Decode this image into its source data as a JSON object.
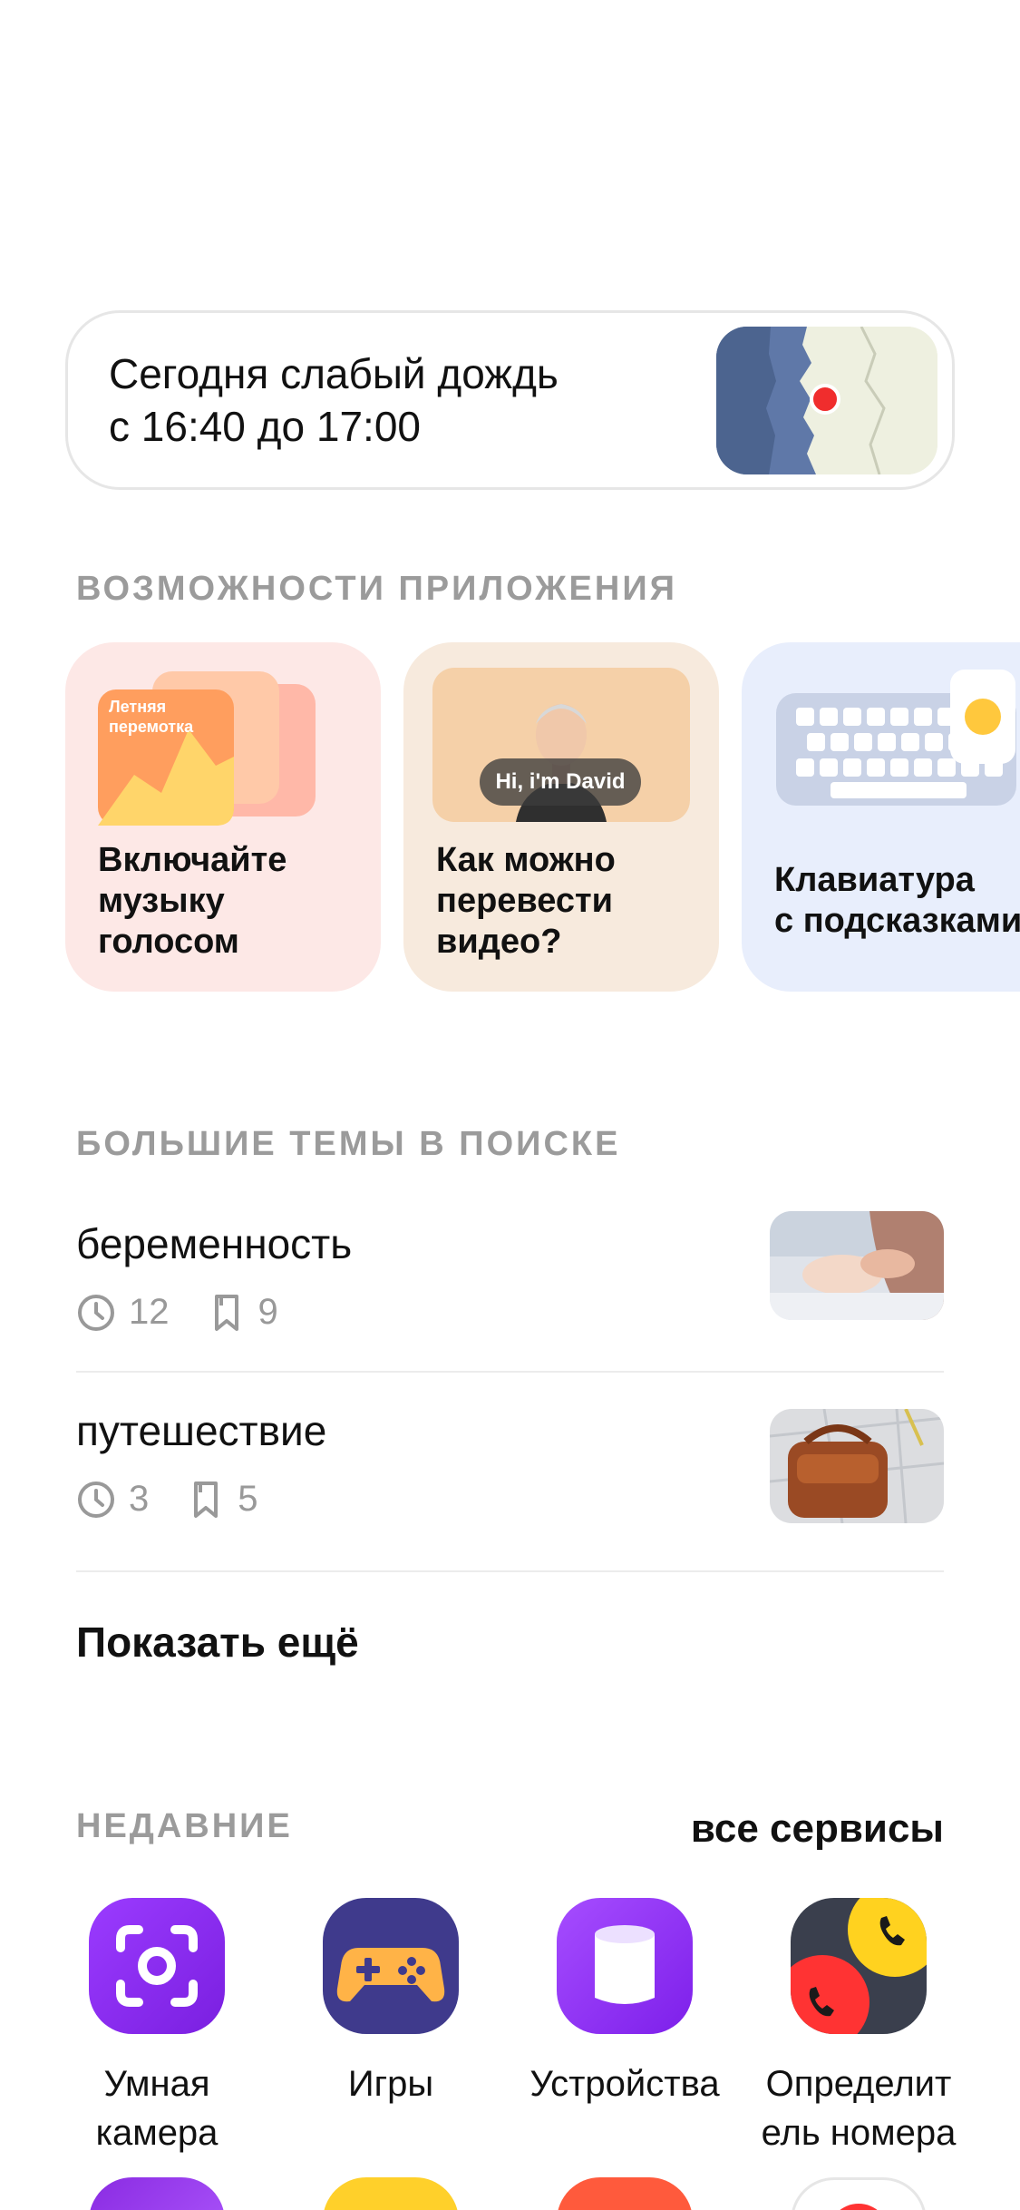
{
  "weather": {
    "line1": "Сегодня слабый дождь",
    "line2": "с 16:40 до 17:00"
  },
  "features": {
    "section_title": "ВОЗМОЖНОСТИ ПРИЛОЖЕНИЯ",
    "cards": [
      {
        "title_lines": [
          "Включайте",
          "музыку",
          "голосом"
        ],
        "thumb_text_lines": [
          "Летняя",
          "перемотка"
        ],
        "bg": "#fde8e6"
      },
      {
        "title_lines": [
          "Как можно",
          "перевести",
          "видео?"
        ],
        "thumb_text": "Hi, i'm David",
        "bg": "#f7eadd"
      },
      {
        "title_lines": [
          "Клавиатура",
          "с подсказками"
        ],
        "bg": "#e8eefc"
      }
    ]
  },
  "topics": {
    "section_title": "БОЛЬШИЕ ТЕМЫ В ПОИСКЕ",
    "items": [
      {
        "title": "беременность",
        "history": "12",
        "bookmarks": "9"
      },
      {
        "title": "путешествие",
        "history": "3",
        "bookmarks": "5"
      }
    ],
    "show_more": "Показать ещё"
  },
  "recent": {
    "section_title": "НЕДАВНИЕ",
    "all_services": "все сервисы",
    "apps": [
      {
        "label_lines": [
          "Умная",
          "камера"
        ],
        "icon": "smart-camera-icon"
      },
      {
        "label_lines": [
          "Игры"
        ],
        "icon": "gamepad-icon"
      },
      {
        "label_lines": [
          "Устройства"
        ],
        "icon": "speaker-device-icon"
      },
      {
        "label_lines": [
          "Определит",
          "ель номера"
        ],
        "icon": "caller-id-icon"
      }
    ]
  },
  "colors": {
    "accent_purple": "#8a2be2",
    "section_gray": "#9b9b9b",
    "call_yellow": "#ffd21f",
    "call_red": "#ff3333"
  }
}
